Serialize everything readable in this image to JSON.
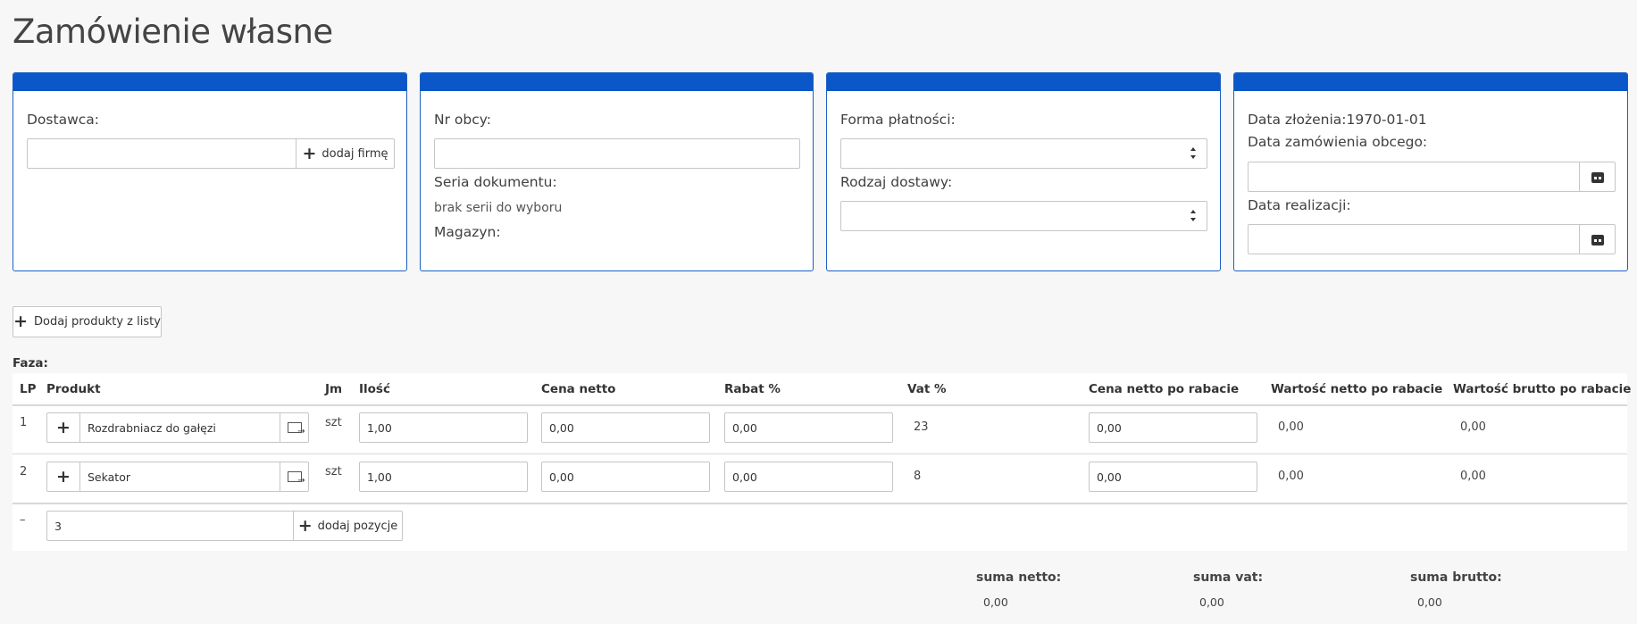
{
  "page": {
    "title": "Zamówienie własne"
  },
  "panel1": {
    "supplier_label": "Dostawca:",
    "supplier_value": "",
    "add_company_label": "dodaj firmę"
  },
  "panel2": {
    "external_no_label": "Nr obcy:",
    "external_no_value": "",
    "series_label": "Seria dokumentu:",
    "series_value": "brak serii do wyboru",
    "warehouse_label": "Magazyn:"
  },
  "panel3": {
    "payment_label": "Forma płatności:",
    "payment_value": "",
    "delivery_label": "Rodzaj dostawy:",
    "delivery_value": ""
  },
  "panel4": {
    "created_label": "Data złożenia:",
    "created_value": "1970-01-01",
    "ext_order_date_label": "Data zamówienia obcego:",
    "ext_order_date_value": "",
    "realization_date_label": "Data realizacji:",
    "realization_date_value": ""
  },
  "toolbar": {
    "add_products_label": "Dodaj produkty z listy"
  },
  "phase": {
    "label": "Faza:"
  },
  "table": {
    "headers": [
      "LP",
      "Produkt",
      "Jm",
      "Ilość",
      "Cena netto",
      "Rabat %",
      "Vat %",
      "Cena netto po rabacie",
      "Wartość netto po rabacie",
      "Wartość brutto po rabacie"
    ],
    "rows": [
      {
        "lp": "1",
        "product": "Rozdrabniacz do gałęzi",
        "unit": "szt",
        "qty": "1,00",
        "net_price": "0,00",
        "discount": "0,00",
        "vat": "23",
        "net_after_discount": "0,00",
        "net_value": "0,00",
        "gross_value": "0,00"
      },
      {
        "lp": "2",
        "product": "Sekator",
        "unit": "szt",
        "qty": "1,00",
        "net_price": "0,00",
        "discount": "0,00",
        "vat": "8",
        "net_after_discount": "0,00",
        "net_value": "0,00",
        "gross_value": "0,00"
      }
    ],
    "new_row": {
      "lp": "–",
      "value": "3",
      "add_label": "dodaj pozycje"
    }
  },
  "summary": {
    "net_label": "suma netto:",
    "net_value": "0,00",
    "vat_label": "suma vat:",
    "vat_value": "0,00",
    "gross_label": "suma brutto:",
    "gross_value": "0,00"
  }
}
